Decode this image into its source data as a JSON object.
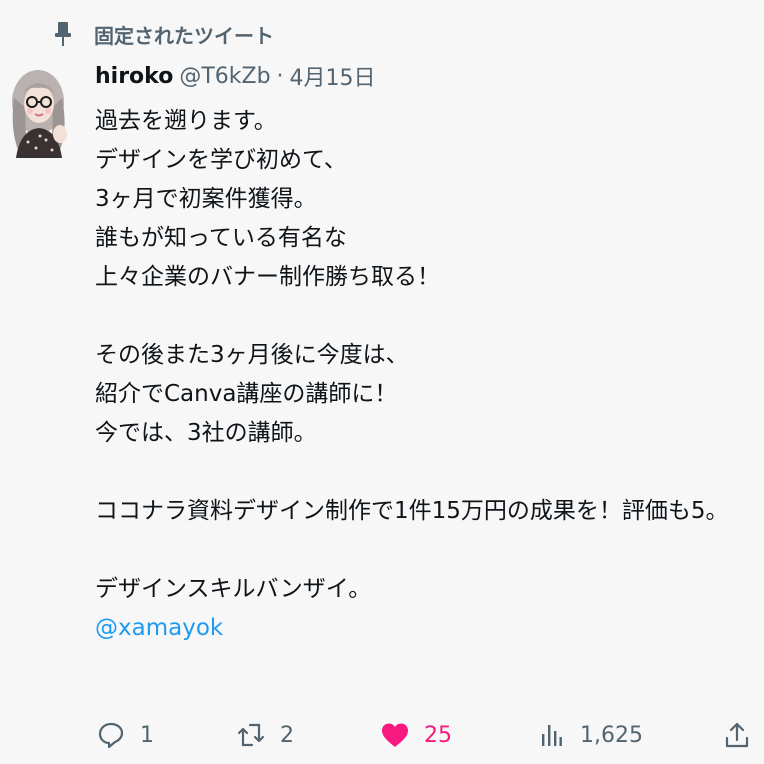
{
  "pinned": {
    "label": "固定されたツイート",
    "icon": "pin-icon"
  },
  "author": {
    "name": "hiroko",
    "handle": "@T6kZb",
    "separator": "·",
    "date": "4月15日"
  },
  "body": {
    "lines": [
      "過去を遡ります。",
      "デザインを学び初めて、",
      "3ヶ月で初案件獲得。",
      "誰もが知っている有名な",
      "上々企業のバナー制作勝ち取る！",
      "",
      "その後また3ヶ月後に今度は、",
      "紹介でCanva講座の講師に！",
      "今では、3社の講師。",
      "",
      "ココナラ資料デザイン制作で1件15万円の成果を！評価も5。",
      "",
      "デザインスキルバンザイ。"
    ],
    "mention": "@xamayok"
  },
  "actions": {
    "reply": {
      "count": "1",
      "icon": "reply-icon"
    },
    "retweet": {
      "count": "2",
      "icon": "retweet-icon"
    },
    "like": {
      "count": "25",
      "icon": "heart-icon",
      "color": "#f91880"
    },
    "views": {
      "count": "1,625",
      "icon": "views-icon"
    },
    "share": {
      "icon": "share-icon"
    }
  },
  "colors": {
    "accent": "#1d9bf0",
    "secondary_text": "#536471",
    "like": "#f91880"
  }
}
